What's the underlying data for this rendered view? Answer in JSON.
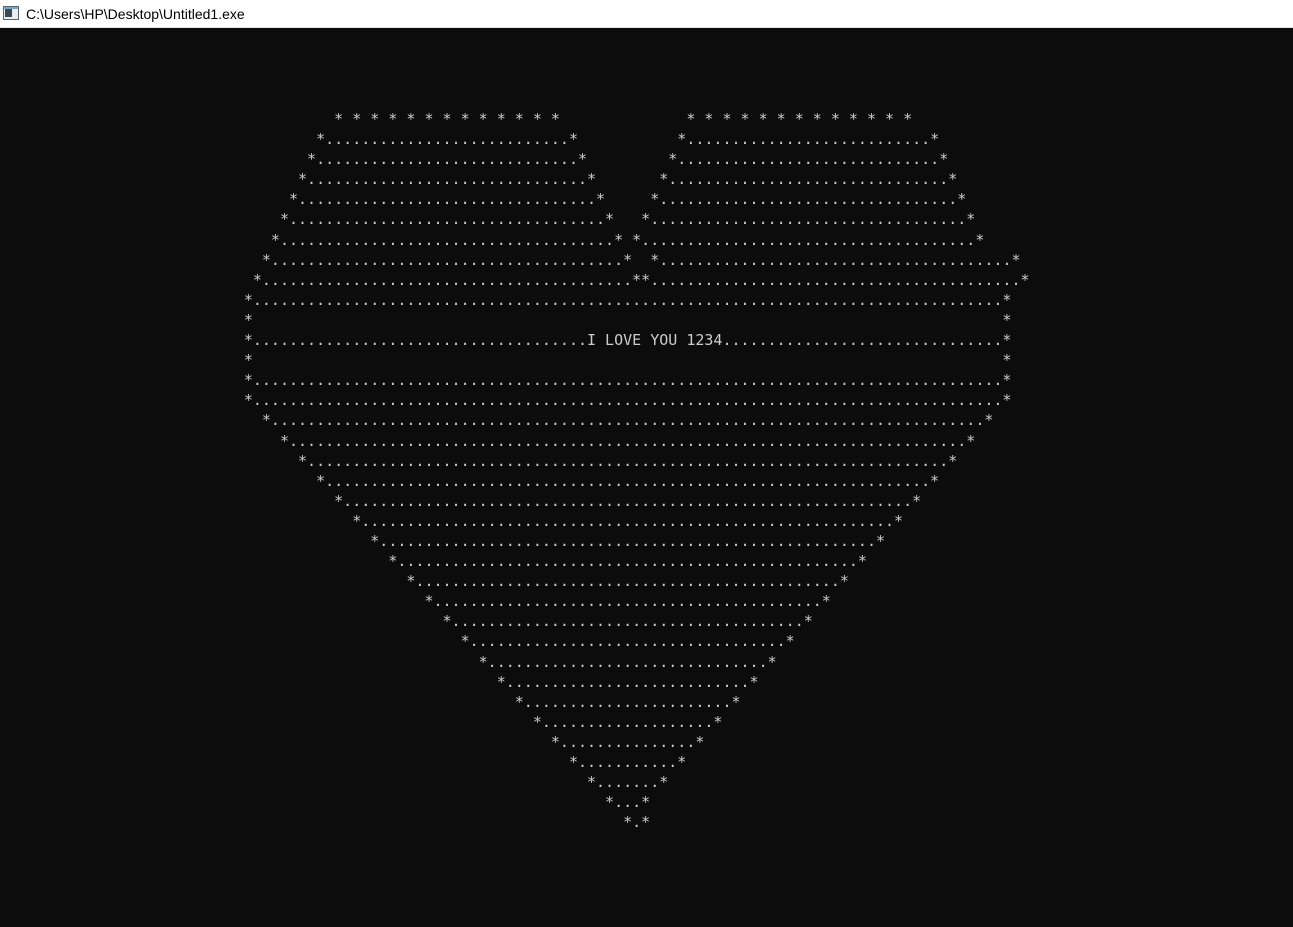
{
  "window": {
    "title": "C:\\Users\\HP\\Desktop\\Untitled1.exe",
    "icon": "console-app-icon"
  },
  "console": {
    "background": "#0c0c0c",
    "foreground": "#cccccc",
    "lines": [
      "                                     * * * * * * * * * * * * *              * * * * * * * * * * * * *",
      "                                   *...........................*           *...........................*",
      "                                  *.............................*         *.............................*",
      "                                 *...............................*       *...............................*",
      "                                *.................................*     *.................................*",
      "                               *...................................*   *...................................*",
      "                              *.....................................* *.....................................*",
      "                             *.......................................*  *.......................................*",
      "                            *.........................................**.........................................*",
      "                           *...................................................................................*",
      "                           *                                                                                   *",
      "                           *.....................................I LOVE YOU 1234...............................*",
      "                           *                                                                                   *",
      "                           *...................................................................................*",
      "                           *...................................................................................*",
      "                             *...............................................................................*",
      "                               *...........................................................................*",
      "                                 *.......................................................................*",
      "                                   *...................................................................*",
      "                                     *...............................................................*",
      "                                       *...........................................................*",
      "                                         *.......................................................*",
      "                                           *...................................................*",
      "                                             *...............................................*",
      "                                               *...........................................*",
      "                                                 *.......................................*",
      "                                                   *...................................*",
      "                                                     *...............................*",
      "                                                       *...........................*",
      "                                                         *.......................*",
      "                                                           *...................*",
      "                                                             *...............*",
      "                                                               *...........*",
      "                                                                 *.......*",
      "                                                                   *...*",
      "                                                                     *.*"
    ]
  }
}
